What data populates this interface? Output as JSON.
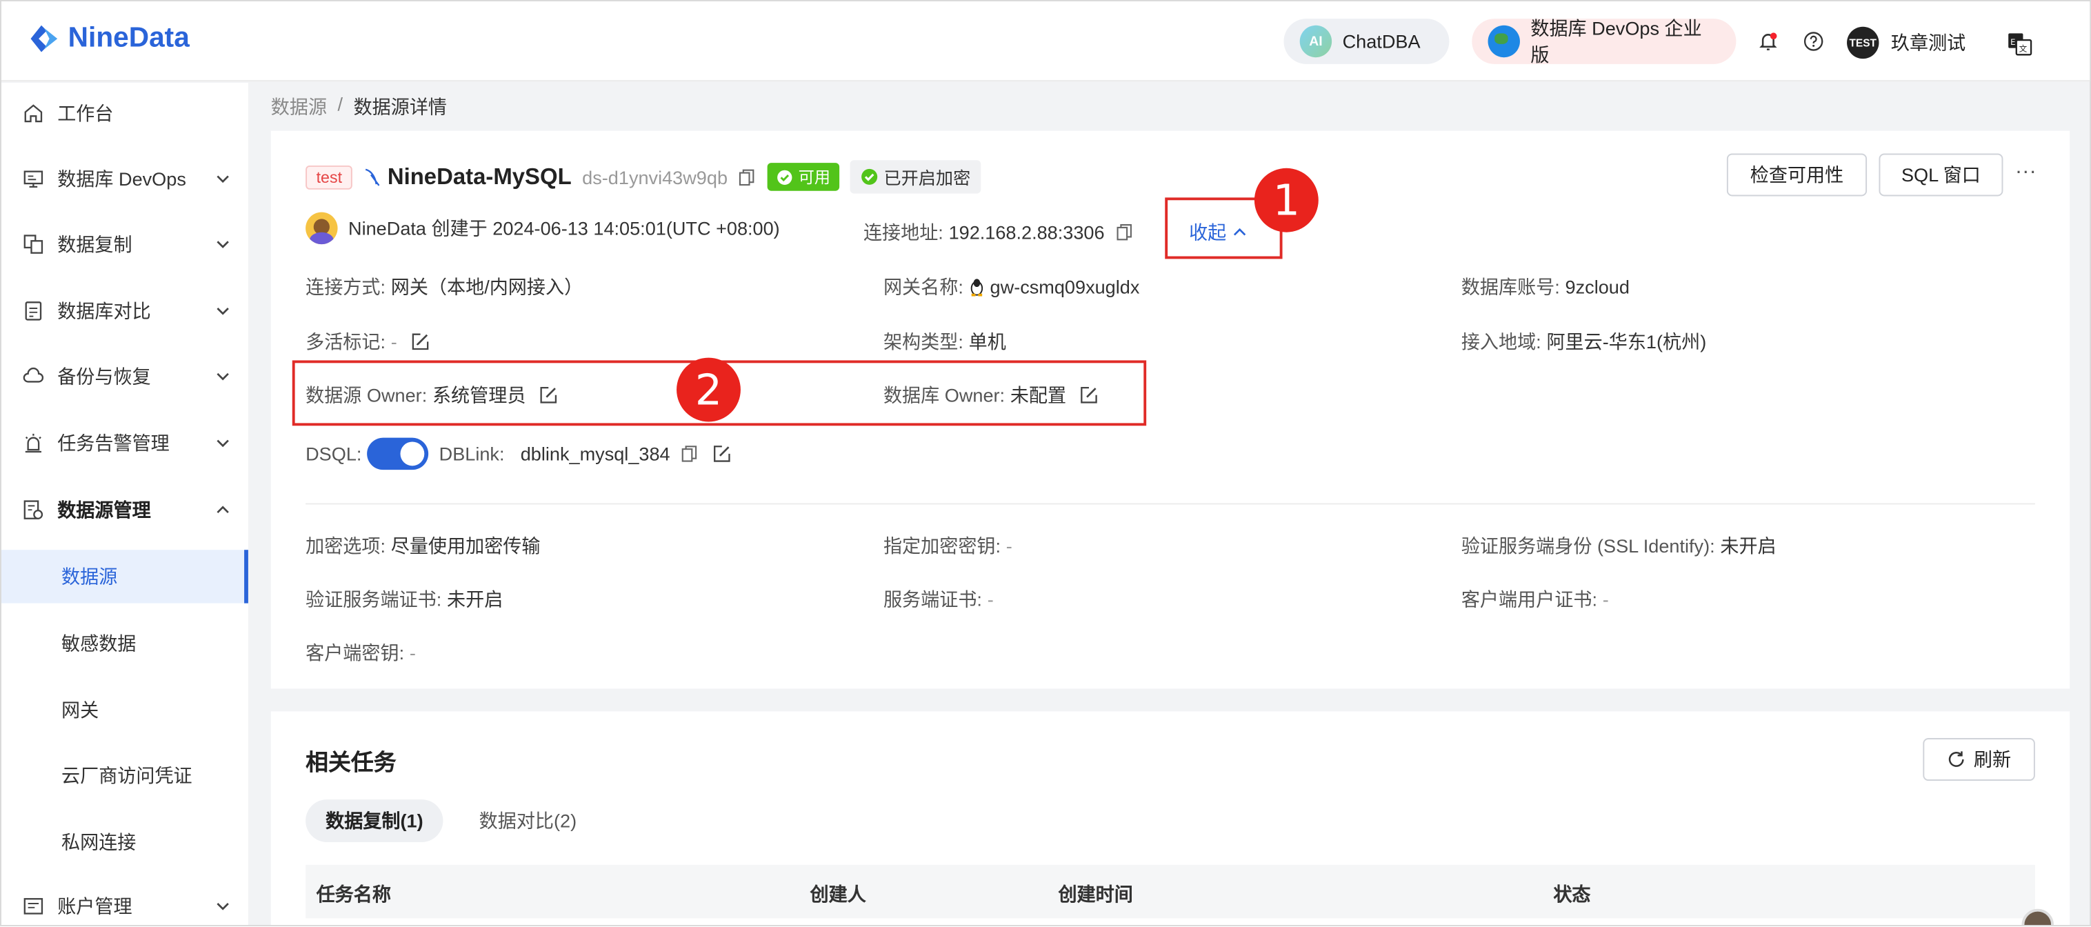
{
  "header": {
    "logo_text": "NineData",
    "chatdba_icon": "AI",
    "chatdba_label": "ChatDBA",
    "devops_label": "数据库 DevOps 企业版",
    "user_avatar_text": "TEST",
    "user_name": "玖章测试"
  },
  "sidebar": {
    "items": [
      {
        "label": "工作台",
        "icon": "home-icon"
      },
      {
        "label": "数据库 DevOps",
        "icon": "monitor-icon"
      },
      {
        "label": "数据复制",
        "icon": "copy-icon"
      },
      {
        "label": "数据库对比",
        "icon": "compare-icon"
      },
      {
        "label": "备份与恢复",
        "icon": "cloud-icon"
      },
      {
        "label": "任务告警管理",
        "icon": "alarm-icon"
      },
      {
        "label": "数据源管理",
        "icon": "datasource-icon"
      }
    ],
    "subitems": [
      "数据源",
      "敏感数据",
      "网关",
      "云厂商访问凭证",
      "私网连接"
    ],
    "account": "账户管理"
  },
  "breadcrumb": {
    "parent": "数据源",
    "sep": "/",
    "current": "数据源详情"
  },
  "datasource": {
    "env_tag": "test",
    "name": "NineData-MySQL",
    "id": "ds-d1ynvi43w9qb",
    "status": "可用",
    "encryption": "已开启加密",
    "creator_info": "NineData 创建于 2024-06-13 14:05:01(UTC +08:00)",
    "address_label": "连接地址:",
    "address": "192.168.2.88:3306",
    "collapse_label": "收起",
    "check_button": "检查可用性",
    "sql_button": "SQL 窗口",
    "more": "···"
  },
  "fields": {
    "conn_mode_k": "连接方式:",
    "conn_mode_v": "网关（本地/内网接入）",
    "gateway_k": "网关名称:",
    "gateway_v": "gw-csmq09xugldx",
    "account_k": "数据库账号:",
    "account_v": "9zcloud",
    "multi_k": "多活标记:",
    "multi_v": "-",
    "arch_k": "架构类型:",
    "arch_v": "单机",
    "region_k": "接入地域:",
    "region_v": "阿里云-华东1(杭州)",
    "ds_owner_k": "数据源 Owner:",
    "ds_owner_v": "系统管理员",
    "db_owner_k": "数据库 Owner:",
    "db_owner_v": "未配置",
    "dsql_k": "DSQL:",
    "dblink_k": "DBLink:",
    "dblink_v": "dblink_mysql_384",
    "enc_opt_k": "加密选项:",
    "enc_opt_v": "尽量使用加密传输",
    "enc_key_k": "指定加密密钥:",
    "enc_key_v": "-",
    "ssl_k": "验证服务端身份 (SSL Identify):",
    "ssl_v": "未开启",
    "srv_cert_verify_k": "验证服务端证书:",
    "srv_cert_verify_v": "未开启",
    "srv_cert_k": "服务端证书:",
    "srv_cert_v": "-",
    "client_cert_k": "客户端用户证书:",
    "client_cert_v": "-",
    "client_key_k": "客户端密钥:",
    "client_key_v": "-"
  },
  "annotations": {
    "one": "1",
    "two": "2"
  },
  "tasks": {
    "title": "相关任务",
    "refresh": "刷新",
    "tab1": "数据复制(1)",
    "tab2": "数据对比(2)",
    "columns": [
      "任务名称",
      "创建人",
      "创建时间",
      "状态"
    ]
  },
  "colors": {
    "brand": "#2a64d9",
    "annotation": "#e02b27",
    "available": "#52c41a"
  }
}
